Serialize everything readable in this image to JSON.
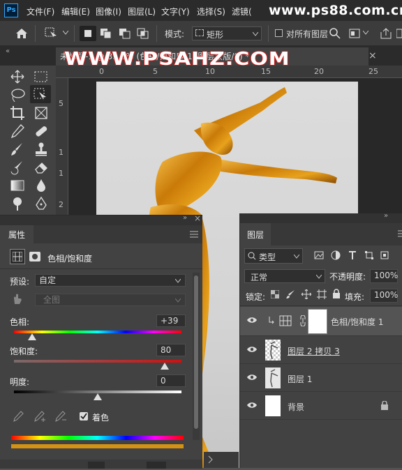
{
  "menubar": {
    "logo": "Ps",
    "items": [
      "文件(F)",
      "编辑(E)",
      "图像(I)",
      "图层(L)",
      "文字(Y)",
      "选择(S)",
      "滤镜("
    ],
    "watermark": "www.ps88.com.cn"
  },
  "options": {
    "mode_label": "模式:",
    "mode_value": "矩形",
    "sample_all_label": "对所有图层"
  },
  "document": {
    "tab_title": "未标题-1 @ 33.3% (色相/饱和度 1, 图层蒙版/8) *",
    "tab_close": "×",
    "watermark": "WWW.PSAHZ.COM",
    "ruler_h": [
      "0",
      "5",
      "10",
      "15",
      "20",
      "25"
    ],
    "ruler_v": [
      "5",
      "1",
      "1",
      "2"
    ]
  },
  "properties": {
    "tab_label": "属性",
    "adjustment_title": "色相/饱和度",
    "preset_label": "预设:",
    "preset_value": "自定",
    "channel_value": "全图",
    "hue_label": "色相:",
    "hue_value": "+39",
    "hue_fraction": 0.11,
    "saturation_label": "饱和度:",
    "saturation_value": "80",
    "saturation_fraction": 0.9,
    "lightness_label": "明度:",
    "lightness_value": "0",
    "lightness_fraction": 0.5,
    "colorize_label": "着色",
    "colorize_checked": true
  },
  "layers": {
    "tab_label": "图层",
    "filter_value": "类型",
    "blend_mode": "正常",
    "opacity_label": "不透明度:",
    "opacity_value": "100%",
    "lock_label": "锁定:",
    "fill_label": "填充:",
    "fill_value": "100%",
    "items": [
      {
        "name": "色相/饱和度 1"
      },
      {
        "name": "图层 2 拷贝 3"
      },
      {
        "name": "图层 1"
      },
      {
        "name": "背景"
      }
    ]
  },
  "colors": {
    "accent": "#31a8ff",
    "gold": "#d4900a",
    "panel": "#424242",
    "dark": "#2b2b2b"
  }
}
